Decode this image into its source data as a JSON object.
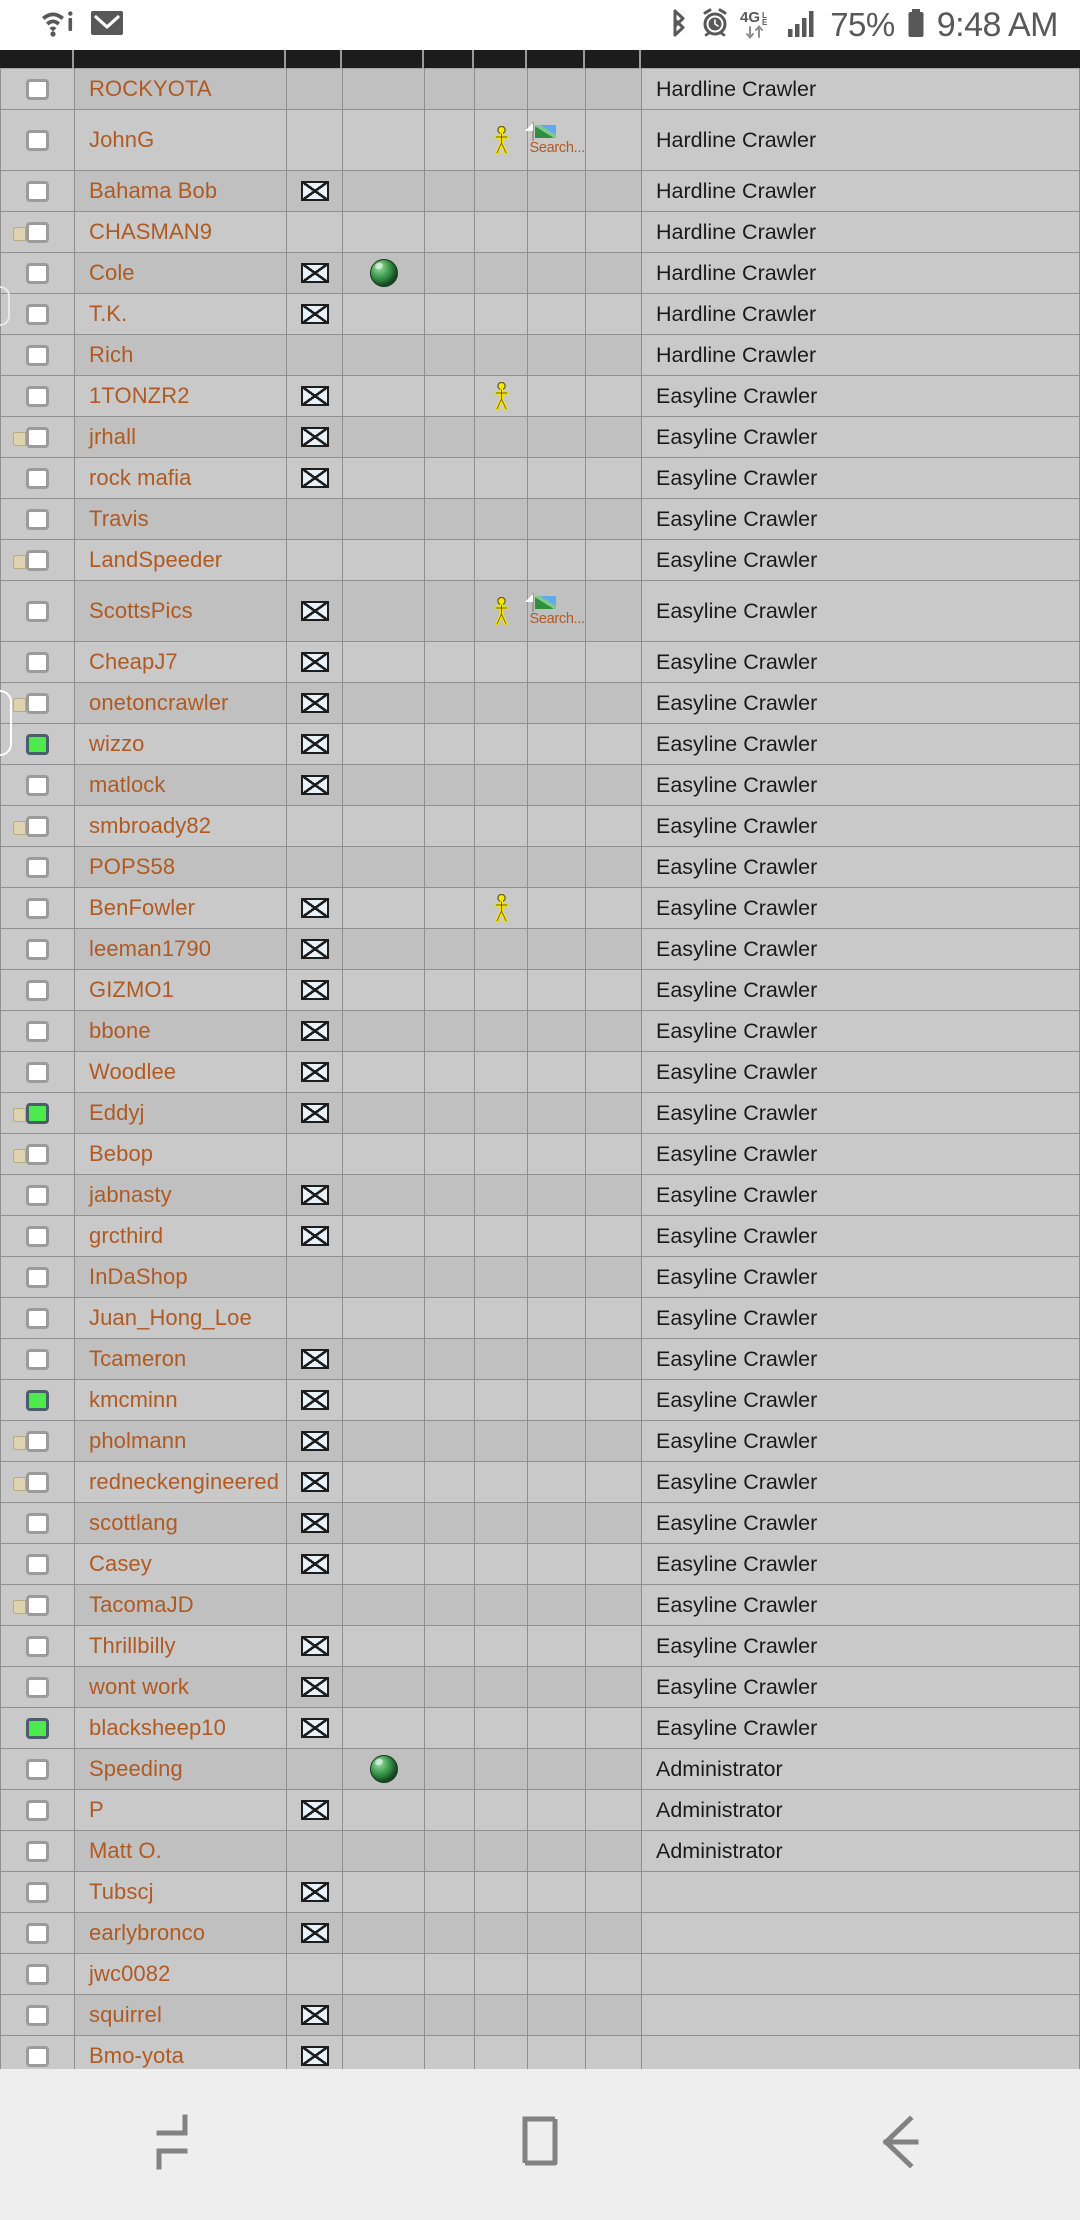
{
  "statusbar": {
    "battery_percent": "75%",
    "time": "9:48 AM",
    "network_label": "4G",
    "icons": [
      "wifi-info-icon",
      "mail-icon",
      "bluetooth-icon",
      "alarm-icon",
      "4g-lte-icon",
      "signal-bars-icon",
      "battery-icon"
    ]
  },
  "table": {
    "rows": [
      {
        "checkbox": "unchecked",
        "username": "ROCKYOTA",
        "mail": false,
        "globe": false,
        "person": false,
        "image": false,
        "rank": "Hardline Crawler",
        "tall": false
      },
      {
        "checkbox": "unchecked",
        "username": "JohnG",
        "mail": false,
        "globe": false,
        "person": true,
        "image": true,
        "rank": "Hardline Crawler",
        "tall": true
      },
      {
        "checkbox": "unchecked",
        "username": "Bahama Bob",
        "mail": true,
        "globe": false,
        "person": false,
        "image": false,
        "rank": "Hardline Crawler",
        "tall": false
      },
      {
        "checkbox": "locked",
        "username": "CHASMAN9",
        "mail": false,
        "globe": false,
        "person": false,
        "image": false,
        "rank": "Hardline Crawler",
        "tall": false
      },
      {
        "checkbox": "unchecked",
        "username": "Cole",
        "mail": true,
        "globe": true,
        "person": false,
        "image": false,
        "rank": "Hardline Crawler",
        "tall": false
      },
      {
        "checkbox": "unchecked",
        "username": "T.K.",
        "mail": true,
        "globe": false,
        "person": false,
        "image": false,
        "rank": "Hardline Crawler",
        "tall": false
      },
      {
        "checkbox": "unchecked",
        "username": "Rich",
        "mail": false,
        "globe": false,
        "person": false,
        "image": false,
        "rank": "Hardline Crawler",
        "tall": false
      },
      {
        "checkbox": "unchecked",
        "username": "1TONZR2",
        "mail": true,
        "globe": false,
        "person": true,
        "image": false,
        "rank": "Easyline Crawler",
        "tall": false
      },
      {
        "checkbox": "locked",
        "username": "jrhall",
        "mail": true,
        "globe": false,
        "person": false,
        "image": false,
        "rank": "Easyline Crawler",
        "tall": false
      },
      {
        "checkbox": "unchecked",
        "username": "rock mafia",
        "mail": true,
        "globe": false,
        "person": false,
        "image": false,
        "rank": "Easyline Crawler",
        "tall": false
      },
      {
        "checkbox": "unchecked",
        "username": "Travis",
        "mail": false,
        "globe": false,
        "person": false,
        "image": false,
        "rank": "Easyline Crawler",
        "tall": false
      },
      {
        "checkbox": "locked",
        "username": "LandSpeeder",
        "mail": false,
        "globe": false,
        "person": false,
        "image": false,
        "rank": "Easyline Crawler",
        "tall": false
      },
      {
        "checkbox": "unchecked",
        "username": "ScottsPics",
        "mail": true,
        "globe": false,
        "person": true,
        "image": true,
        "rank": "Easyline Crawler",
        "tall": true
      },
      {
        "checkbox": "unchecked",
        "username": "CheapJ7",
        "mail": true,
        "globe": false,
        "person": false,
        "image": false,
        "rank": "Easyline Crawler",
        "tall": false
      },
      {
        "checkbox": "locked",
        "username": "onetoncrawler",
        "mail": true,
        "globe": false,
        "person": false,
        "image": false,
        "rank": "Easyline Crawler",
        "tall": false
      },
      {
        "checkbox": "green",
        "username": "wizzo",
        "mail": true,
        "globe": false,
        "person": false,
        "image": false,
        "rank": "Easyline Crawler",
        "tall": false
      },
      {
        "checkbox": "unchecked",
        "username": "matlock",
        "mail": true,
        "globe": false,
        "person": false,
        "image": false,
        "rank": "Easyline Crawler",
        "tall": false
      },
      {
        "checkbox": "locked",
        "username": "smbroady82",
        "mail": false,
        "globe": false,
        "person": false,
        "image": false,
        "rank": "Easyline Crawler",
        "tall": false
      },
      {
        "checkbox": "unchecked",
        "username": "POPS58",
        "mail": false,
        "globe": false,
        "person": false,
        "image": false,
        "rank": "Easyline Crawler",
        "tall": false
      },
      {
        "checkbox": "unchecked",
        "username": "BenFowler",
        "mail": true,
        "globe": false,
        "person": true,
        "image": false,
        "rank": "Easyline Crawler",
        "tall": false
      },
      {
        "checkbox": "unchecked",
        "username": "leeman1790",
        "mail": true,
        "globe": false,
        "person": false,
        "image": false,
        "rank": "Easyline Crawler",
        "tall": false
      },
      {
        "checkbox": "unchecked",
        "username": "GIZMO1",
        "mail": true,
        "globe": false,
        "person": false,
        "image": false,
        "rank": "Easyline Crawler",
        "tall": false
      },
      {
        "checkbox": "unchecked",
        "username": "bbone",
        "mail": true,
        "globe": false,
        "person": false,
        "image": false,
        "rank": "Easyline Crawler",
        "tall": false
      },
      {
        "checkbox": "unchecked",
        "username": "Woodlee",
        "mail": true,
        "globe": false,
        "person": false,
        "image": false,
        "rank": "Easyline Crawler",
        "tall": false
      },
      {
        "checkbox": "green-locked",
        "username": "Eddyj",
        "mail": true,
        "globe": false,
        "person": false,
        "image": false,
        "rank": "Easyline Crawler",
        "tall": false
      },
      {
        "checkbox": "locked",
        "username": "Bebop",
        "mail": false,
        "globe": false,
        "person": false,
        "image": false,
        "rank": "Easyline Crawler",
        "tall": false
      },
      {
        "checkbox": "unchecked",
        "username": "jabnasty",
        "mail": true,
        "globe": false,
        "person": false,
        "image": false,
        "rank": "Easyline Crawler",
        "tall": false
      },
      {
        "checkbox": "unchecked",
        "username": "grcthird",
        "mail": true,
        "globe": false,
        "person": false,
        "image": false,
        "rank": "Easyline Crawler",
        "tall": false
      },
      {
        "checkbox": "unchecked",
        "username": "InDaShop",
        "mail": false,
        "globe": false,
        "person": false,
        "image": false,
        "rank": "Easyline Crawler",
        "tall": false
      },
      {
        "checkbox": "unchecked",
        "username": "Juan_Hong_Loe",
        "mail": false,
        "globe": false,
        "person": false,
        "image": false,
        "rank": "Easyline Crawler",
        "tall": false
      },
      {
        "checkbox": "unchecked",
        "username": "Tcameron",
        "mail": true,
        "globe": false,
        "person": false,
        "image": false,
        "rank": "Easyline Crawler",
        "tall": false
      },
      {
        "checkbox": "green",
        "username": "kmcminn",
        "mail": true,
        "globe": false,
        "person": false,
        "image": false,
        "rank": "Easyline Crawler",
        "tall": false
      },
      {
        "checkbox": "locked",
        "username": "pholmann",
        "mail": true,
        "globe": false,
        "person": false,
        "image": false,
        "rank": "Easyline Crawler",
        "tall": false
      },
      {
        "checkbox": "locked",
        "username": "redneckengineered",
        "mail": true,
        "globe": false,
        "person": false,
        "image": false,
        "rank": "Easyline Crawler",
        "tall": false
      },
      {
        "checkbox": "unchecked",
        "username": "scottlang",
        "mail": true,
        "globe": false,
        "person": false,
        "image": false,
        "rank": "Easyline Crawler",
        "tall": false
      },
      {
        "checkbox": "unchecked",
        "username": "Casey",
        "mail": true,
        "globe": false,
        "person": false,
        "image": false,
        "rank": "Easyline Crawler",
        "tall": false
      },
      {
        "checkbox": "locked",
        "username": "TacomaJD",
        "mail": false,
        "globe": false,
        "person": false,
        "image": false,
        "rank": "Easyline Crawler",
        "tall": false
      },
      {
        "checkbox": "unchecked",
        "username": "Thrillbilly",
        "mail": true,
        "globe": false,
        "person": false,
        "image": false,
        "rank": "Easyline Crawler",
        "tall": false
      },
      {
        "checkbox": "unchecked",
        "username": "wont work",
        "mail": true,
        "globe": false,
        "person": false,
        "image": false,
        "rank": "Easyline Crawler",
        "tall": false
      },
      {
        "checkbox": "green",
        "username": "blacksheep10",
        "mail": true,
        "globe": false,
        "person": false,
        "image": false,
        "rank": "Easyline Crawler",
        "tall": false
      },
      {
        "checkbox": "unchecked",
        "username": "Speeding",
        "mail": false,
        "globe": true,
        "person": false,
        "image": false,
        "rank": "Administrator",
        "tall": false
      },
      {
        "checkbox": "unchecked",
        "username": "P",
        "mail": true,
        "globe": false,
        "person": false,
        "image": false,
        "rank": "Administrator",
        "tall": false
      },
      {
        "checkbox": "unchecked",
        "username": "Matt O.",
        "mail": false,
        "globe": false,
        "person": false,
        "image": false,
        "rank": "Administrator",
        "tall": false
      },
      {
        "checkbox": "unchecked",
        "username": "Tubscj",
        "mail": true,
        "globe": false,
        "person": false,
        "image": false,
        "rank": "",
        "tall": false
      },
      {
        "checkbox": "unchecked",
        "username": "earlybronco",
        "mail": true,
        "globe": false,
        "person": false,
        "image": false,
        "rank": "",
        "tall": false
      },
      {
        "checkbox": "unchecked",
        "username": "jwc0082",
        "mail": false,
        "globe": false,
        "person": false,
        "image": false,
        "rank": "",
        "tall": false
      },
      {
        "checkbox": "unchecked",
        "username": "squirrel",
        "mail": true,
        "globe": false,
        "person": false,
        "image": false,
        "rank": "",
        "tall": false
      },
      {
        "checkbox": "unchecked",
        "username": "Bmo-yota",
        "mail": true,
        "globe": false,
        "person": false,
        "image": false,
        "rank": "",
        "tall": false
      }
    ],
    "image_caption": "Search..."
  },
  "navbar": {
    "recents_label": "recents-icon",
    "home_label": "home-icon",
    "back_label": "back-icon"
  }
}
